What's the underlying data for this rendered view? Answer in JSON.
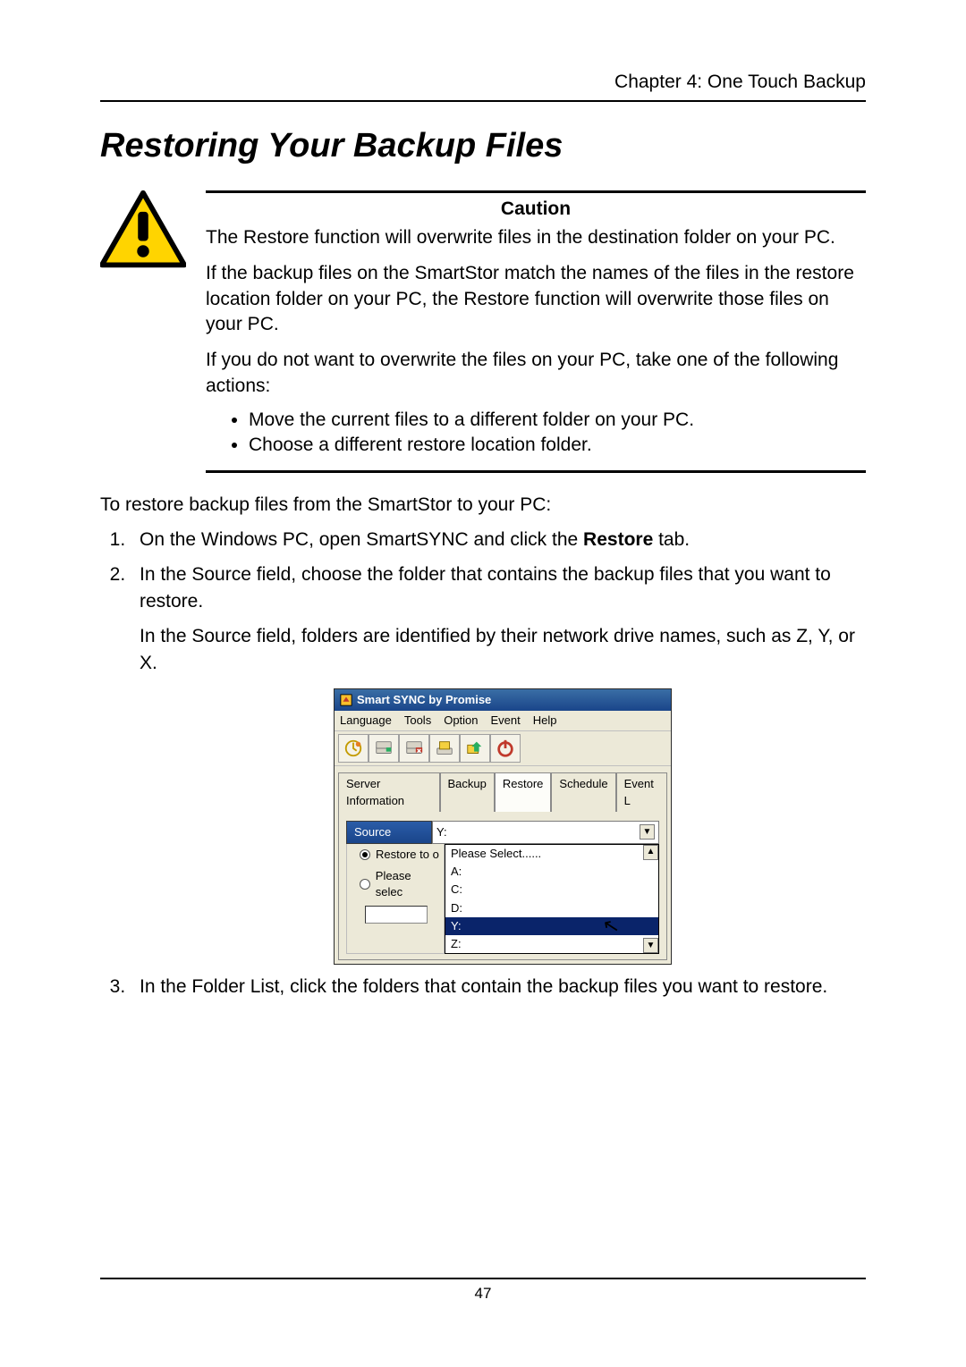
{
  "header": {
    "chapter": "Chapter 4: One Touch Backup"
  },
  "title": "Restoring Your Backup Files",
  "caution": {
    "heading": "Caution",
    "p1": "The Restore function will overwrite files in the destination folder on your PC.",
    "p2": "If the backup files on the SmartStor match the names of the files in the restore location folder on your PC, the Restore function will overwrite those files on your PC.",
    "p3": "If you do not want to overwrite the files on your PC, take one of the following actions:",
    "bullets": [
      "Move the current files to a different folder on your PC.",
      "Choose a different restore location folder."
    ]
  },
  "intro": "To restore backup files from the SmartStor to your PC:",
  "steps": {
    "s1_pre": "On the Windows PC, open SmartSYNC and click the ",
    "s1_bold": "Restore",
    "s1_post": " tab.",
    "s2a": "In the Source field, choose the folder that contains the backup files that you want to restore.",
    "s2b": "In the Source field, folders are identified by their network drive names, such as Z, Y, or X.",
    "s3": "In the Folder List, click the folders that contain the backup files you want to restore."
  },
  "app": {
    "title": "Smart SYNC by Promise",
    "menus": [
      "Language",
      "Tools",
      "Option",
      "Event",
      "Help"
    ],
    "toolbar_icons": [
      "server-icon",
      "map-drive-icon",
      "unmap-drive-icon",
      "open-share-icon",
      "browser-icon",
      "power-icon"
    ],
    "tabs": [
      "Server Information",
      "Backup",
      "Restore",
      "Schedule",
      "Event L"
    ],
    "active_tab": "Restore",
    "source_label": "Source",
    "source_value": "Y:",
    "radio1": "Restore to o",
    "radio2": "Please selec",
    "dropdown": {
      "placeholder": "Please Select......",
      "options": [
        "A:",
        "C:",
        "D:",
        "Y:",
        "Z:"
      ],
      "selected": "Y:"
    }
  },
  "page_number": "47"
}
